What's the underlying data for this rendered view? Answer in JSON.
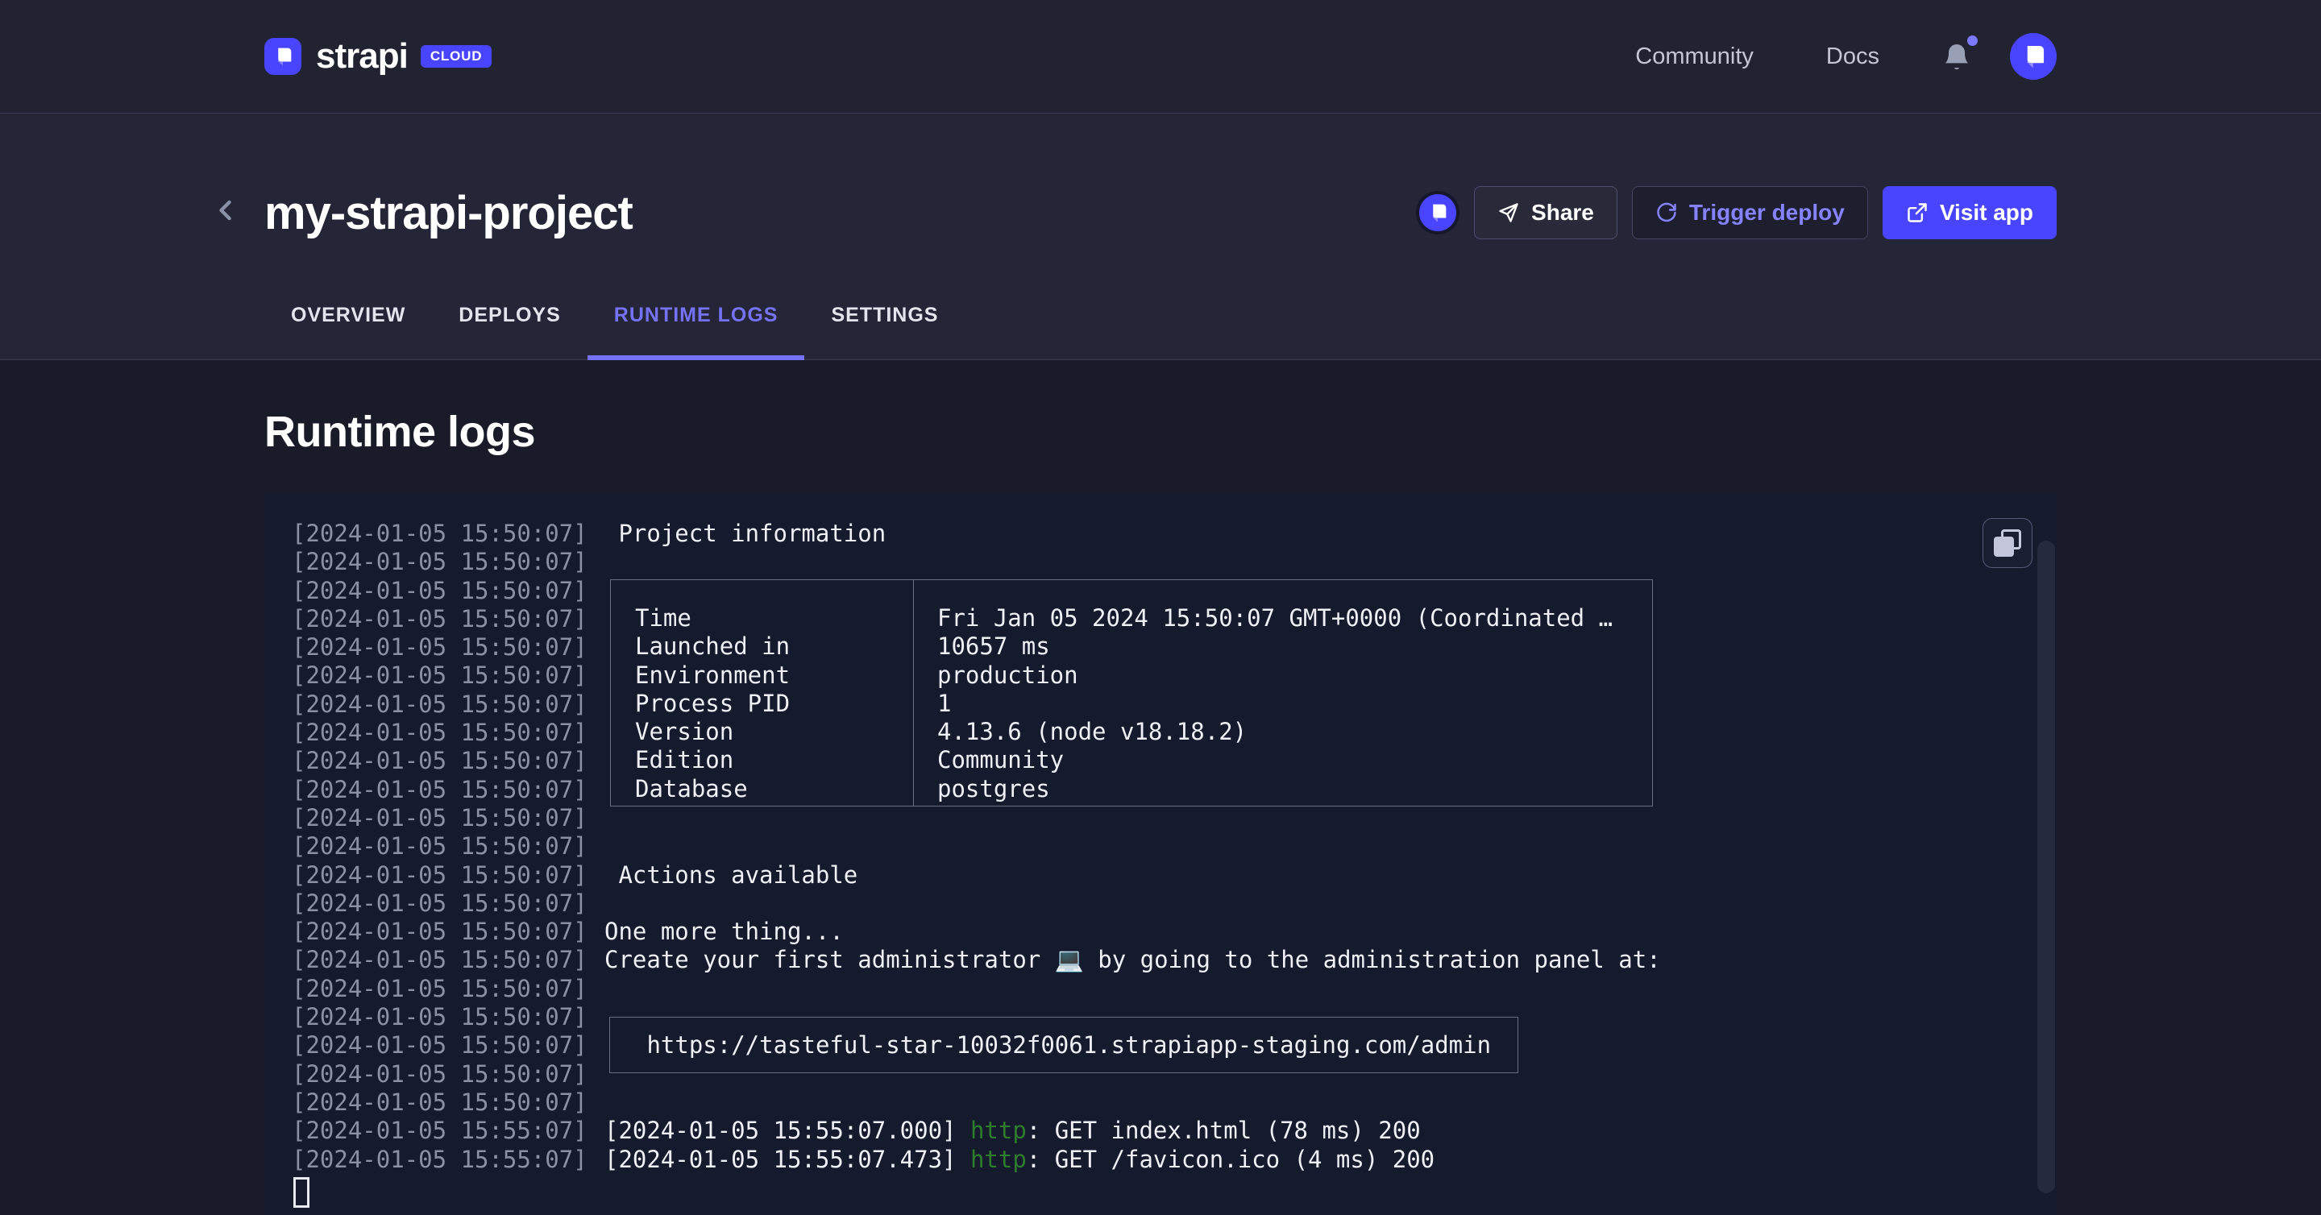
{
  "colors": {
    "brand_purple": "#4945ff",
    "accent_light": "#7b79ff",
    "active_tab": "#7672f6",
    "http_green": "#2d7d2d",
    "console_bg": "#151a2c",
    "timestamp_gray": "#8b90a3"
  },
  "header": {
    "brand": "strapi",
    "badge": "CLOUD",
    "nav": [
      {
        "label": "Community"
      },
      {
        "label": "Docs"
      }
    ]
  },
  "project": {
    "title": "my-strapi-project",
    "buttons": {
      "share": "Share",
      "trigger": "Trigger deploy",
      "visit": "Visit app"
    },
    "tabs": [
      {
        "label": "OVERVIEW",
        "active": false
      },
      {
        "label": "DEPLOYS",
        "active": false
      },
      {
        "label": "RUNTIME LOGS",
        "active": true
      },
      {
        "label": "SETTINGS",
        "active": false
      }
    ]
  },
  "logs": {
    "heading": "Runtime logs",
    "gutter": [
      "[2024-01-05 15:50:07]",
      "[2024-01-05 15:50:07]",
      "[2024-01-05 15:50:07]",
      "[2024-01-05 15:50:07]",
      "[2024-01-05 15:50:07]",
      "[2024-01-05 15:50:07]",
      "[2024-01-05 15:50:07]",
      "[2024-01-05 15:50:07]",
      "[2024-01-05 15:50:07]",
      "[2024-01-05 15:50:07]",
      "[2024-01-05 15:50:07]",
      "[2024-01-05 15:50:07]",
      "[2024-01-05 15:50:07]",
      "[2024-01-05 15:50:07]",
      "[2024-01-05 15:50:07]",
      "[2024-01-05 15:50:07]",
      "[2024-01-05 15:50:07]",
      "[2024-01-05 15:50:07]",
      "[2024-01-05 15:50:07]",
      "[2024-01-05 15:50:07]",
      "[2024-01-05 15:50:07]",
      "[2024-01-05 15:55:07]",
      "[2024-01-05 15:55:07]"
    ],
    "content_rows": [
      {
        "t": " Project information"
      },
      {
        "t": ""
      },
      {
        "t": ""
      },
      {
        "t": ""
      },
      {
        "t": ""
      },
      {
        "t": ""
      },
      {
        "t": ""
      },
      {
        "t": ""
      },
      {
        "t": ""
      },
      {
        "t": ""
      },
      {
        "t": ""
      },
      {
        "t": ""
      },
      {
        "t": " Actions available"
      },
      {
        "t": ""
      },
      {
        "t": "One more thing..."
      },
      {
        "t": "Create your first administrator 💻 by going to the administration panel at:"
      },
      {
        "t": ""
      },
      {
        "t": ""
      },
      {
        "t": ""
      },
      {
        "t": ""
      },
      {
        "t": ""
      },
      {
        "http": true,
        "prefix": "[2024-01-05 15:55:07.000] ",
        "token": "http",
        "rest": ": GET index.html (78 ms) 200"
      },
      {
        "http": true,
        "prefix": "[2024-01-05 15:55:07.473] ",
        "token": "http",
        "rest": ": GET /favicon.ico (4 ms) 200"
      }
    ],
    "table": [
      {
        "label": "Time",
        "value": "Fri Jan 05 2024 15:50:07 GMT+0000 (Coordinated …"
      },
      {
        "label": "Launched in",
        "value": "10657 ms"
      },
      {
        "label": "Environment",
        "value": "production"
      },
      {
        "label": "Process PID",
        "value": "1"
      },
      {
        "label": "Version",
        "value": "4.13.6 (node v18.18.2)"
      },
      {
        "label": "Edition",
        "value": "Community"
      },
      {
        "label": "Database",
        "value": "postgres"
      }
    ],
    "admin_url": " https://tasteful-star-10032f0061.strapiapp-staging.com/admin"
  }
}
